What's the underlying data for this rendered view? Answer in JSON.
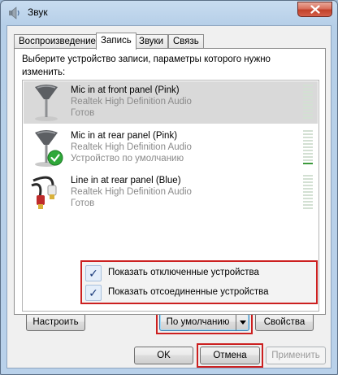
{
  "window": {
    "title": "Звук"
  },
  "tabs": [
    {
      "label": "Воспроизведение",
      "active": false
    },
    {
      "label": "Запись",
      "active": true
    },
    {
      "label": "Звуки",
      "active": false
    },
    {
      "label": "Связь",
      "active": false
    }
  ],
  "instruction": "Выберите устройство записи, параметры которого нужно изменить:",
  "devices": [
    {
      "name": "Mic in at front panel (Pink)",
      "driver": "Realtek High Definition Audio",
      "status": "Готов",
      "icon": "microphone-icon",
      "selected": true
    },
    {
      "name": "Mic in at rear panel (Pink)",
      "driver": "Realtek High Definition Audio",
      "status": "Устройство по умолчанию",
      "icon": "microphone-default-icon",
      "selected": false
    },
    {
      "name": "Line in at rear panel (Blue)",
      "driver": "Realtek High Definition Audio",
      "status": "Готов",
      "icon": "line-in-cable-icon",
      "selected": false
    }
  ],
  "context_menu": {
    "items": [
      {
        "label": "Показать отключенные устройства",
        "checked": true
      },
      {
        "label": "Показать отсоединенные устройства",
        "checked": true
      }
    ]
  },
  "buttons": {
    "configure": "Настроить",
    "set_default": "По умолчанию",
    "properties": "Свойства",
    "ok": "OK",
    "cancel": "Отмена",
    "apply": "Применить"
  },
  "colors": {
    "highlight": "#cc2020",
    "default_check": "#2fa83a",
    "close_button": "#c2412a"
  }
}
